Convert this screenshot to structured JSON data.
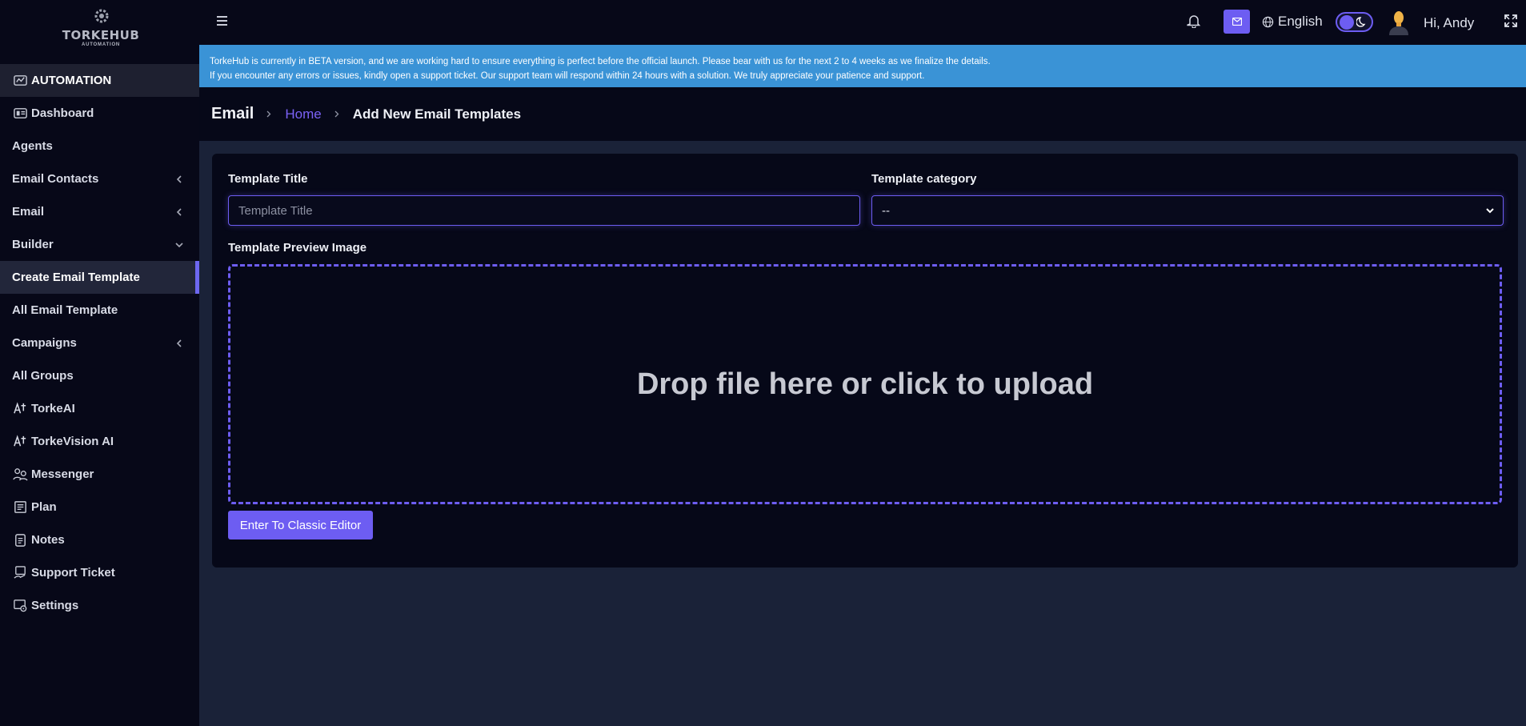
{
  "brand": {
    "name": "TORKEHUB",
    "tagline": "AUTOMATION"
  },
  "sidebar": {
    "items": [
      {
        "label": "AUTOMATION",
        "icon": "automation-icon"
      },
      {
        "label": "Dashboard",
        "icon": "dashboard-icon"
      },
      {
        "label": "Agents"
      },
      {
        "label": "Email Contacts",
        "chevron": "chevron-left-icon"
      },
      {
        "label": "Email",
        "chevron": "chevron-left-icon"
      },
      {
        "label": "Builder",
        "chevron": "chevron-down-icon"
      },
      {
        "label": "Create Email Template",
        "active": true
      },
      {
        "label": "All Email Template"
      },
      {
        "label": "Campaigns",
        "chevron": "chevron-left-icon"
      },
      {
        "label": "All Groups"
      },
      {
        "label": "TorkeAI",
        "icon": "ai-sparkle-icon"
      },
      {
        "label": "TorkeVision AI",
        "icon": "ai-sparkle-icon"
      },
      {
        "label": "Messenger",
        "icon": "messenger-icon"
      },
      {
        "label": "Plan",
        "icon": "plan-icon"
      },
      {
        "label": "Notes",
        "icon": "notes-icon"
      },
      {
        "label": "Support Ticket",
        "icon": "support-ticket-icon"
      },
      {
        "label": "Settings",
        "icon": "settings-icon"
      }
    ]
  },
  "topbar": {
    "language": "English",
    "greeting": "Hi, Andy",
    "icons": [
      "menu-icon",
      "bell-icon",
      "mail-icon",
      "globe-icon",
      "moon-icon",
      "expand-icon"
    ]
  },
  "banner": {
    "line1": "TorkeHub is currently in BETA version, and we are working hard to ensure everything is perfect before the official launch. Please bear with us for the next 2 to 4 weeks as we finalize the details.",
    "line2": "If you encounter any errors or issues, kindly open a support ticket. Our support team will respond within 24 hours with a solution. We truly appreciate your patience and support."
  },
  "page": {
    "title": "Email",
    "breadcrumb_home": "Home",
    "breadcrumb_current": "Add New Email Templates"
  },
  "form": {
    "title_label": "Template Title",
    "title_placeholder": "Template Title",
    "title_value": "",
    "category_label": "Template category",
    "category_value": "--",
    "preview_label": "Template Preview Image",
    "dropzone_text": "Drop file here or click to upload",
    "classic_button": "Enter To Classic Editor"
  },
  "colors": {
    "accent": "#6d5df2",
    "banner": "#3a93d6",
    "sidebar_bg": "#070818",
    "content_bg": "#1a2238"
  }
}
